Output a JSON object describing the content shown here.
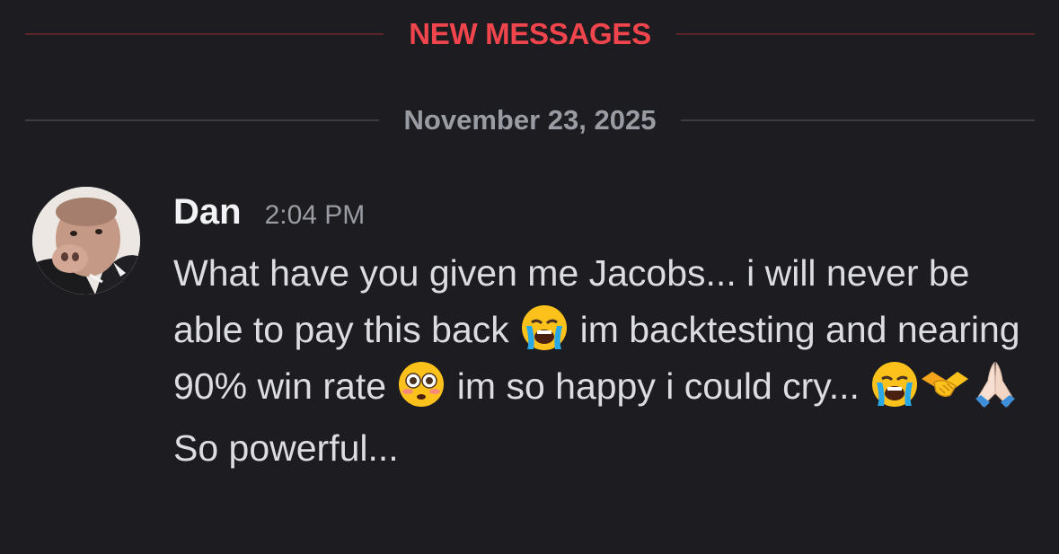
{
  "dividers": {
    "new_messages": "NEW MESSAGES",
    "date": "November 23, 2025"
  },
  "message": {
    "author": "Dan",
    "timestamp": "2:04 PM",
    "avatar_icon": "pig-avatar-icon",
    "body": [
      {
        "type": "text",
        "value": "What have you given me Jacobs... i will never be able to pay this back "
      },
      {
        "type": "emoji",
        "name": "loudly-crying-face-icon"
      },
      {
        "type": "text",
        "value": " im backtesting and nearing 90% win rate "
      },
      {
        "type": "emoji",
        "name": "flushed-face-icon"
      },
      {
        "type": "text",
        "value": " im so happy i could cry... "
      },
      {
        "type": "emoji",
        "name": "loudly-crying-face-icon"
      },
      {
        "type": "emoji",
        "name": "handshake-icon"
      },
      {
        "type": "emoji",
        "name": "folded-hands-icon"
      }
    ],
    "second_line": "So powerful..."
  },
  "colors": {
    "background": "#1c1c21",
    "new_messages_accent": "#f0454c",
    "muted_text": "#9a9ca4",
    "message_text": "#dcdde1"
  }
}
